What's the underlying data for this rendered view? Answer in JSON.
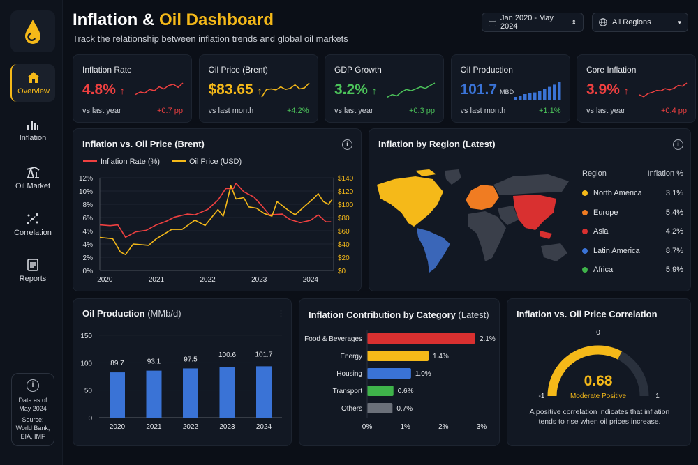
{
  "header": {
    "title_part1": "Inflation & ",
    "title_part2": "Oil Dashboard",
    "subtitle": "Track the relationship between inflation trends and global oil markets",
    "date_range": "Jan 2020 - May 2024",
    "region_select": "All Regions"
  },
  "sidebar": {
    "items": [
      {
        "label": "Overview",
        "icon": "home-icon",
        "active": true
      },
      {
        "label": "Inflation",
        "icon": "bar-chart-icon"
      },
      {
        "label": "Oil Market",
        "icon": "oil-pump-icon"
      },
      {
        "label": "Correlation",
        "icon": "scatter-icon"
      },
      {
        "label": "Reports",
        "icon": "report-icon"
      }
    ],
    "info": {
      "line1": "Data as of",
      "line2": "May 2024",
      "line3": "Source:",
      "line4": "World Bank,",
      "line5": "EIA, IMF"
    }
  },
  "colors": {
    "accent": "#f5b919",
    "red": "#ef4040",
    "green": "#4cc35a",
    "blue": "#3a73d6",
    "gray": "#6b7079"
  },
  "kpis": [
    {
      "title": "Inflation Rate",
      "value": "4.8%",
      "arrow": "↑",
      "compare": "vs last year",
      "delta": "+0.7 pp",
      "color": "#ef4040",
      "delta_color": "#ef4040",
      "spark": [
        2,
        3,
        2.6,
        4,
        3.5,
        5,
        4.2,
        5.5,
        6,
        4.8,
        6.5
      ]
    },
    {
      "title": "Oil Price (Brent)",
      "value": "$83.65",
      "arrow": "↑",
      "compare": "vs last month",
      "delta": "+4.2%",
      "color": "#f5b919",
      "delta_color": "#4cc35a",
      "spark": [
        1,
        4,
        4.2,
        3.8,
        5,
        4,
        4.4,
        5.8,
        4.2,
        4.6,
        6.5
      ]
    },
    {
      "title": "GDP Growth",
      "value": "3.2%",
      "arrow": "↑",
      "compare": "vs last year",
      "delta": "+0.3 pp",
      "color": "#4cc35a",
      "delta_color": "#4cc35a",
      "spark": [
        1,
        2,
        1.5,
        3,
        4,
        3.5,
        4.2,
        5,
        4.4,
        5.5,
        6.5
      ]
    },
    {
      "title": "Oil Production",
      "value": "101.7",
      "unit": "MBD",
      "compare": "vs last month",
      "delta": "+1.1%",
      "color": "#3a73d6",
      "delta_color": "#4cc35a",
      "spark": [
        1,
        1.5,
        2,
        2.3,
        2.6,
        3.2,
        3.8,
        4.6,
        5.4,
        6.5
      ]
    },
    {
      "title": "Core Inflation",
      "value": "3.9%",
      "arrow": "↑",
      "compare": "vs last year",
      "delta": "+0.4 pp",
      "color": "#ef4040",
      "delta_color": "#ef4040",
      "spark": [
        2,
        1.2,
        2.5,
        3,
        3.8,
        3.6,
        4.5,
        4,
        4.6,
        5.8,
        5.5,
        6.8
      ]
    }
  ],
  "chart_data": [
    {
      "type": "line",
      "title": "Inflation vs. Oil Price (Brent)",
      "legend": [
        "Inflation Rate (%)",
        "Oil Price (USD)"
      ],
      "x_ticks": [
        "2020",
        "2021",
        "2022",
        "2023",
        "2024"
      ],
      "y_left_ticks": [
        "0%",
        "2%",
        "4%",
        "4%",
        "6%",
        "8%",
        "10%",
        "12%"
      ],
      "y_left_range": [
        0,
        12
      ],
      "y_right_ticks": [
        "$0",
        "$20",
        "$40",
        "$60",
        "$80",
        "$100",
        "$120",
        "$140"
      ],
      "y_right_range": [
        0,
        140
      ],
      "x_range": [
        2019.9,
        2024.45
      ],
      "series": [
        {
          "name": "Inflation Rate (%)",
          "color": "#ef4040",
          "points": [
            [
              2019.9,
              5.9
            ],
            [
              2020.1,
              5.8
            ],
            [
              2020.25,
              5.9
            ],
            [
              2020.4,
              4.3
            ],
            [
              2020.6,
              5.0
            ],
            [
              2020.8,
              5.2
            ],
            [
              2021.0,
              5.9
            ],
            [
              2021.2,
              6.4
            ],
            [
              2021.35,
              6.9
            ],
            [
              2021.6,
              7.3
            ],
            [
              2021.75,
              7.2
            ],
            [
              2022.0,
              7.9
            ],
            [
              2022.2,
              9.1
            ],
            [
              2022.35,
              10.6
            ],
            [
              2022.5,
              10.6
            ],
            [
              2022.55,
              11.3
            ],
            [
              2022.7,
              10.2
            ],
            [
              2022.9,
              9.5
            ],
            [
              2023.05,
              8.4
            ],
            [
              2023.2,
              7.2
            ],
            [
              2023.45,
              7.3
            ],
            [
              2023.6,
              6.6
            ],
            [
              2023.8,
              6.2
            ],
            [
              2024.0,
              6.5
            ],
            [
              2024.15,
              7.2
            ],
            [
              2024.3,
              6.3
            ],
            [
              2024.4,
              6.3
            ]
          ]
        },
        {
          "name": "Oil Price (USD)",
          "color": "#f5b919",
          "points": [
            [
              2019.9,
              50
            ],
            [
              2020.15,
              48
            ],
            [
              2020.3,
              28
            ],
            [
              2020.4,
              24
            ],
            [
              2020.55,
              40
            ],
            [
              2020.85,
              38
            ],
            [
              2021.0,
              48
            ],
            [
              2021.3,
              62
            ],
            [
              2021.5,
              62
            ],
            [
              2021.75,
              76
            ],
            [
              2021.95,
              68
            ],
            [
              2022.2,
              92
            ],
            [
              2022.3,
              82
            ],
            [
              2022.35,
              96
            ],
            [
              2022.45,
              128
            ],
            [
              2022.55,
              108
            ],
            [
              2022.7,
              110
            ],
            [
              2022.8,
              96
            ],
            [
              2022.95,
              94
            ],
            [
              2023.1,
              86
            ],
            [
              2023.25,
              82
            ],
            [
              2023.35,
              104
            ],
            [
              2023.55,
              92
            ],
            [
              2023.7,
              84
            ],
            [
              2023.9,
              98
            ],
            [
              2024.05,
              108
            ],
            [
              2024.15,
              116
            ],
            [
              2024.25,
              104
            ],
            [
              2024.35,
              100
            ],
            [
              2024.42,
              107
            ]
          ]
        }
      ]
    },
    {
      "type": "bar",
      "title": "Oil Production",
      "title_unit": "(MMb/d)",
      "categories": [
        "2020",
        "2021",
        "2022",
        "2023",
        "2024"
      ],
      "values": [
        89.7,
        93.1,
        97.5,
        100.6,
        101.7
      ],
      "y_ticks": [
        "0",
        "50",
        "100",
        "150"
      ],
      "ylim": [
        0,
        150
      ]
    },
    {
      "type": "bar",
      "orientation": "horizontal",
      "title": "Inflation Contribution by Category",
      "title_suffix": "(Latest)",
      "categories": [
        "Food & Beverages",
        "Energy",
        "Housing",
        "Transport",
        "Others"
      ],
      "values": [
        2.1,
        1.4,
        1.0,
        0.6,
        0.7
      ],
      "labels": [
        "2.1%",
        "1.4%",
        "1.0%",
        "0.6%",
        "0.7%"
      ],
      "colors": [
        "#d93030",
        "#f5b919",
        "#3a73d6",
        "#3fb34a",
        "#6b7079"
      ],
      "x_ticks": [
        "0%",
        "1%",
        "2%",
        "3%"
      ],
      "xlim": [
        0,
        3
      ]
    }
  ],
  "region_map": {
    "title": "Inflation by Region (Latest)",
    "col_region": "Region",
    "col_value": "Inflation %",
    "rows": [
      {
        "name": "North America",
        "value": "3.1%",
        "color": "#f5b919"
      },
      {
        "name": "Europe",
        "value": "5.4%",
        "color": "#f07c22"
      },
      {
        "name": "Asia",
        "value": "4.2%",
        "color": "#d93030"
      },
      {
        "name": "Latin America",
        "value": "8.7%",
        "color": "#3a73d6"
      },
      {
        "name": "Africa",
        "value": "5.9%",
        "color": "#3fb34a"
      }
    ]
  },
  "correlation": {
    "title": "Inflation vs. Oil Price Correlation",
    "value": 0.68,
    "value_label": "0.68",
    "strength": "Moderate Positive",
    "min_label": "-1",
    "mid_label": "0",
    "max_label": "1",
    "note": "A positive correlation indicates that inflation tends to rise when oil prices increase."
  }
}
